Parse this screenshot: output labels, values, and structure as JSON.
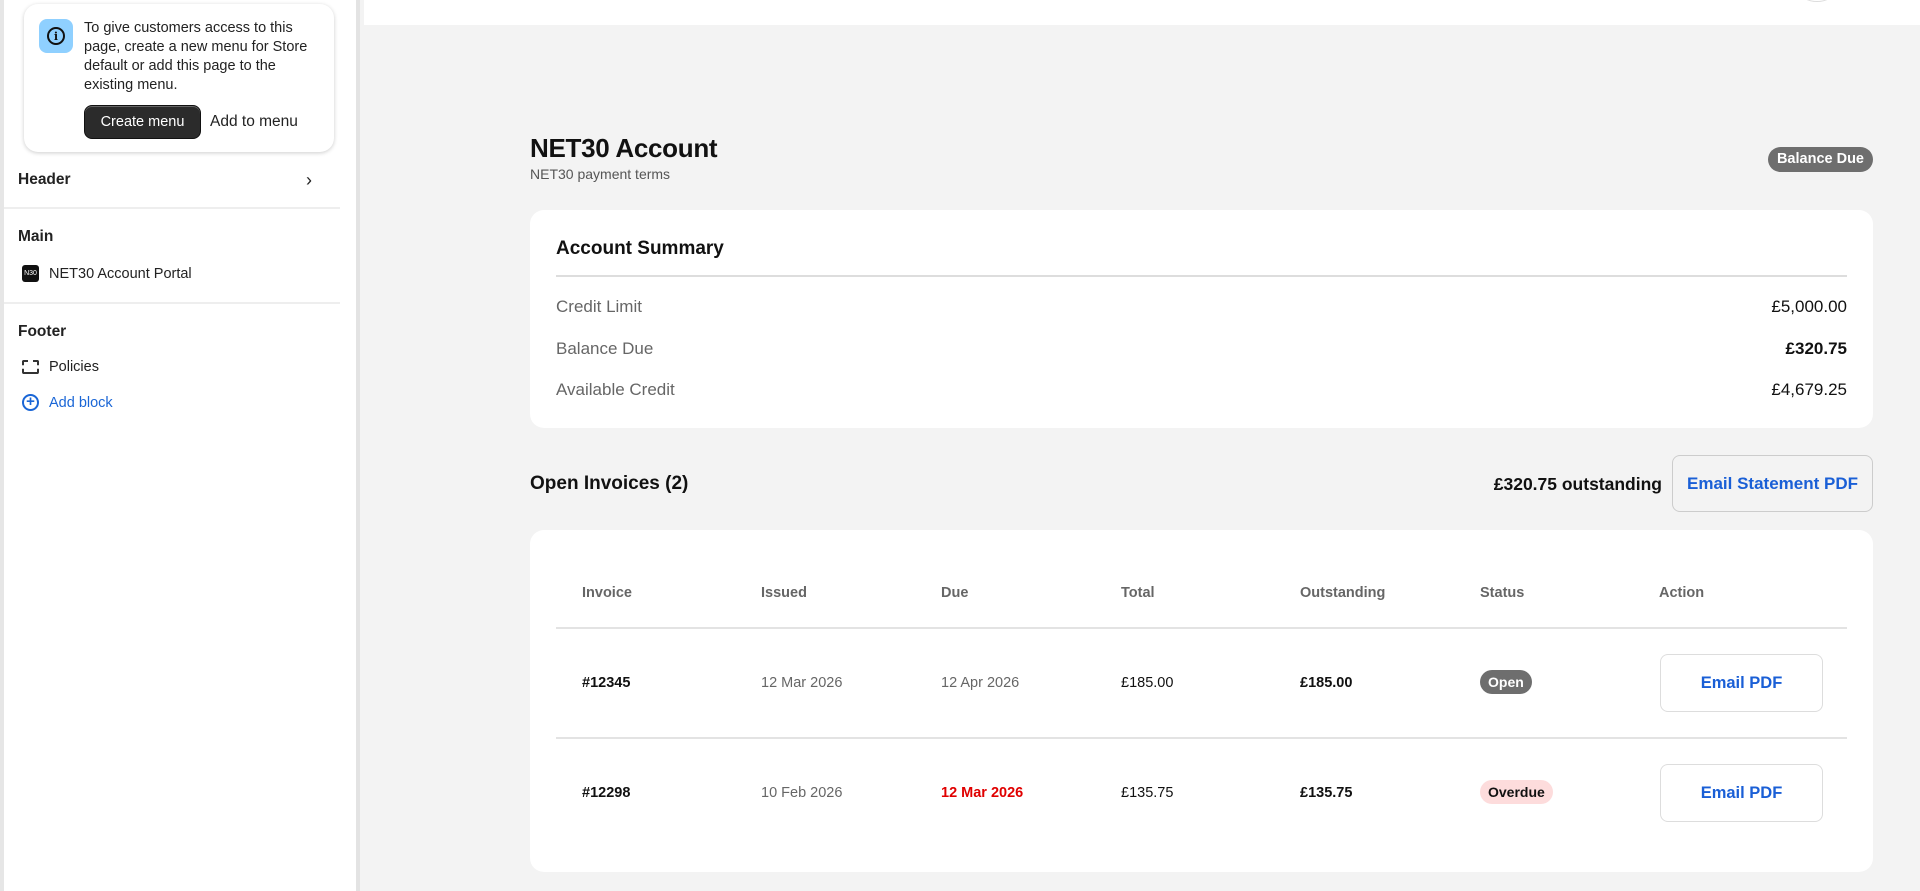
{
  "sidebar": {
    "notice": {
      "text": "To give customers access to this page, create a new menu for Store default or add this page to the existing menu.",
      "create_label": "Create menu",
      "add_label": "Add to menu"
    },
    "header_label": "Header",
    "main_label": "Main",
    "main_items": [
      {
        "label": "NET30 Account Portal",
        "icon": "app-logo-icon",
        "logo_text": "N30"
      }
    ],
    "footer_label": "Footer",
    "footer_items": [
      {
        "label": "Policies",
        "icon": "section-icon"
      }
    ],
    "add_block_label": "Add block"
  },
  "page": {
    "title": "NET30 Account",
    "subtitle": "NET30 payment terms",
    "badge": "Balance Due"
  },
  "summary": {
    "heading": "Account Summary",
    "rows": [
      {
        "label": "Credit Limit",
        "value": "£5,000.00"
      },
      {
        "label": "Balance Due",
        "value": "£320.75"
      },
      {
        "label": "Available Credit",
        "value": "£4,679.25"
      }
    ]
  },
  "invoices": {
    "heading": "Open Invoices (2)",
    "outstanding": "£320.75 outstanding",
    "statement_button": "Email Statement PDF",
    "columns": [
      "Invoice",
      "Issued",
      "Due",
      "Total",
      "Outstanding",
      "Status",
      "Action"
    ],
    "rows": [
      {
        "invoice": "#12345",
        "issued": "12 Mar 2026",
        "due": "12 Apr 2026",
        "total": "£185.00",
        "outstanding": "£185.00",
        "status": "Open",
        "action": "Email PDF"
      },
      {
        "invoice": "#12298",
        "issued": "10 Feb 2026",
        "due": "12 Mar 2026",
        "total": "£135.75",
        "outstanding": "£135.75",
        "status": "Overdue",
        "action": "Email PDF"
      }
    ]
  },
  "colors": {
    "link": "#1a5fd6",
    "overdue_text": "#e00000",
    "overdue_badge": "#fddcdc",
    "open_badge": "#6e6e6e"
  }
}
